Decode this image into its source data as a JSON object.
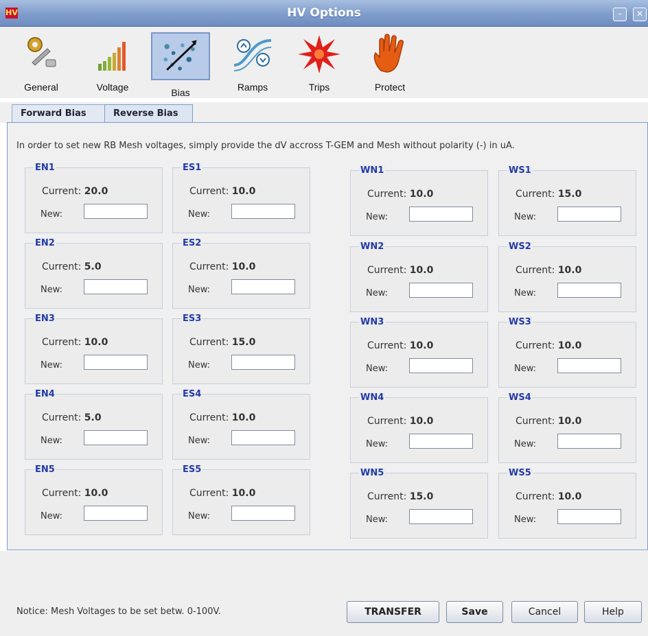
{
  "window": {
    "title": "HV Options",
    "logo_text": "HV",
    "minimize_glyph": "–",
    "close_glyph": "✕"
  },
  "toolbar": {
    "items": [
      {
        "label": "General",
        "icon": "gear-wrench-icon"
      },
      {
        "label": "Voltage",
        "icon": "signal-bars-icon"
      },
      {
        "label": "Bias",
        "icon": "bias-particles-icon"
      },
      {
        "label": "Ramps",
        "icon": "ramps-arrows-icon"
      },
      {
        "label": "Trips",
        "icon": "trip-burst-icon"
      },
      {
        "label": "Protect",
        "icon": "hand-stop-icon"
      }
    ],
    "selected": "Bias"
  },
  "tabs": [
    {
      "label": "Forward Bias"
    },
    {
      "label": "Reverse Bias"
    }
  ],
  "selected_tab": "Reverse Bias",
  "instructions": "In order to set new RB Mesh voltages, simply provide the dV accross T-GEM and Mesh without polarity (-) in uA.",
  "current_label": "Current:",
  "new_label": "New:",
  "groups": {
    "EN1": {
      "title": "EN1",
      "current": "20.0",
      "new": ""
    },
    "EN2": {
      "title": "EN2",
      "current": "5.0",
      "new": ""
    },
    "EN3": {
      "title": "EN3",
      "current": "10.0",
      "new": ""
    },
    "EN4": {
      "title": "EN4",
      "current": "5.0",
      "new": ""
    },
    "EN5": {
      "title": "EN5",
      "current": "10.0",
      "new": ""
    },
    "ES1": {
      "title": "ES1",
      "current": "10.0",
      "new": ""
    },
    "ES2": {
      "title": "ES2",
      "current": "10.0",
      "new": ""
    },
    "ES3": {
      "title": "ES3",
      "current": "15.0",
      "new": ""
    },
    "ES4": {
      "title": "ES4",
      "current": "10.0",
      "new": ""
    },
    "ES5": {
      "title": "ES5",
      "current": "10.0",
      "new": ""
    },
    "WN1": {
      "title": "WN1",
      "current": "10.0",
      "new": ""
    },
    "WN2": {
      "title": "WN2",
      "current": "10.0",
      "new": ""
    },
    "WN3": {
      "title": "WN3",
      "current": "10.0",
      "new": ""
    },
    "WN4": {
      "title": "WN4",
      "current": "10.0",
      "new": ""
    },
    "WN5": {
      "title": "WN5",
      "current": "15.0",
      "new": ""
    },
    "WS1": {
      "title": "WS1",
      "current": "15.0",
      "new": ""
    },
    "WS2": {
      "title": "WS2",
      "current": "10.0",
      "new": ""
    },
    "WS3": {
      "title": "WS3",
      "current": "10.0",
      "new": ""
    },
    "WS4": {
      "title": "WS4",
      "current": "10.0",
      "new": ""
    },
    "WS5": {
      "title": "WS5",
      "current": "10.0",
      "new": ""
    }
  },
  "notice": "Notice: Mesh Voltages to be set betw. 0-100V.",
  "buttons": {
    "transfer": "TRANSFER",
    "save": "Save",
    "cancel": "Cancel",
    "help": "Help"
  }
}
